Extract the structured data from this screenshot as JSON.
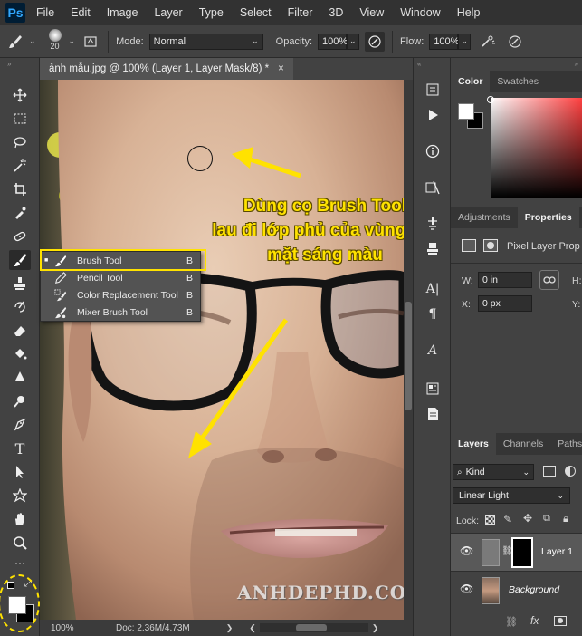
{
  "app": {
    "logo": "Ps"
  },
  "menu": [
    "File",
    "Edit",
    "Image",
    "Layer",
    "Type",
    "Select",
    "Filter",
    "3D",
    "View",
    "Window",
    "Help"
  ],
  "options": {
    "brush_size": "20",
    "mode_label": "Mode:",
    "mode_value": "Normal",
    "opacity_label": "Opacity:",
    "opacity_value": "100%",
    "flow_label": "Flow:",
    "flow_value": "100%"
  },
  "document": {
    "tab_title": "ảnh mẫu.jpg @ 100% (Layer 1, Layer Mask/8) *",
    "zoom": "100%",
    "doc_info": "Doc: 2.36M/4.73M"
  },
  "flyout": {
    "items": [
      {
        "label": "Brush Tool",
        "key": "B"
      },
      {
        "label": "Pencil Tool",
        "key": "B"
      },
      {
        "label": "Color Replacement Tool",
        "key": "B"
      },
      {
        "label": "Mixer Brush Tool",
        "key": "B"
      }
    ]
  },
  "annotation": {
    "line1": "Dùng cọ Brush Tool",
    "line2": "lau đi lớp phủ của vùng da",
    "line3": "mặt sáng màu",
    "color": "#ffe200"
  },
  "watermark": "ANHDEPHD.COM",
  "color_panel": {
    "tabs": [
      "Color",
      "Swatches"
    ]
  },
  "properties_panel": {
    "tabs": [
      "Adjustments",
      "Properties"
    ],
    "title": "Pixel Layer Prop",
    "w_label": "W:",
    "w_value": "0 in",
    "h_label": "H:",
    "x_label": "X:",
    "x_value": "0 px",
    "y_label": "Y:"
  },
  "layers_panel": {
    "tabs": [
      "Layers",
      "Channels",
      "Paths"
    ],
    "filter": "Kind",
    "blend_mode": "Linear Light",
    "lock_label": "Lock:",
    "layers": [
      {
        "name": "Layer 1"
      },
      {
        "name": "Background"
      }
    ]
  },
  "colors": {
    "accent_yellow": "#ffe200",
    "ps_blue": "#31a8ff"
  }
}
